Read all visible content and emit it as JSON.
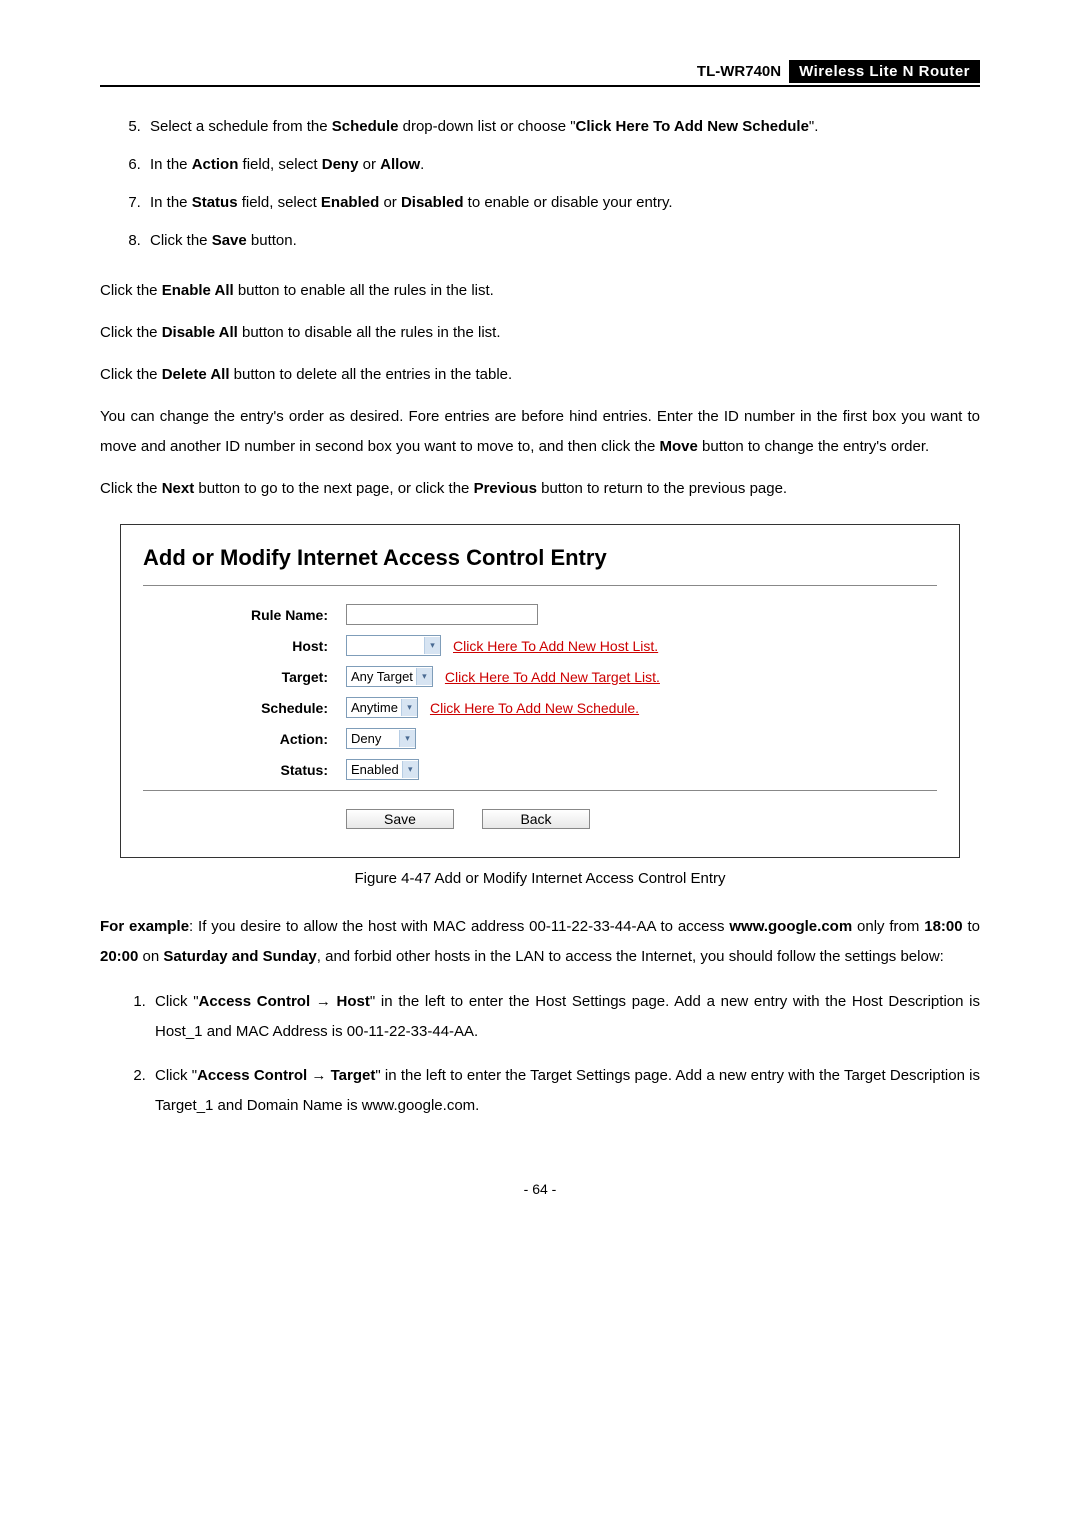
{
  "header": {
    "model": "TL-WR740N",
    "desc": "Wireless Lite N Router"
  },
  "steps": {
    "s5_pre": "Select a schedule from the ",
    "s5_b1": "Schedule",
    "s5_mid": " drop-down list or choose \"",
    "s5_b2": "Click Here To Add New Schedule",
    "s5_post": "\".",
    "s6_pre": "In the ",
    "s6_b1": "Action",
    "s6_mid1": " field, select ",
    "s6_b2": "Deny",
    "s6_mid2": " or ",
    "s6_b3": "Allow",
    "s6_post": ".",
    "s7_pre": "In the ",
    "s7_b1": "Status",
    "s7_mid1": " field, select ",
    "s7_b2": "Enabled",
    "s7_mid2": " or ",
    "s7_b3": "Disabled",
    "s7_post": " to enable or disable your entry.",
    "s8_pre": " Click the ",
    "s8_b1": "Save",
    "s8_post": " button."
  },
  "paras": {
    "p1_pre": "Click the ",
    "p1_b": "Enable All",
    "p1_post": " button to enable all the rules in the list.",
    "p2_pre": "Click the ",
    "p2_b": "Disable All",
    "p2_post": " button to disable all the rules in the list.",
    "p3_pre": "Click the ",
    "p3_b": "Delete All",
    "p3_post": " button to delete all the entries in the table.",
    "p4_pre": "You can change the entry's order as desired. Fore entries are before hind entries. Enter the ID number in the first box you want to move and another ID number in second box you want to move to, and then click the ",
    "p4_b": "Move",
    "p4_post": " button to change the entry's order.",
    "p5_pre": "Click the ",
    "p5_b1": "Next",
    "p5_mid": " button to go to the next page, or click the ",
    "p5_b2": "Previous",
    "p5_post": " button to return to the previous page."
  },
  "figure": {
    "title": "Add or Modify Internet Access Control Entry",
    "labels": {
      "rule": "Rule Name:",
      "host": "Host:",
      "target": "Target:",
      "schedule": "Schedule:",
      "action": "Action:",
      "status": "Status:"
    },
    "values": {
      "host": "",
      "target": "Any Target",
      "schedule": "Anytime",
      "action": "Deny",
      "status": "Enabled"
    },
    "links": {
      "host": "Click Here To Add New Host List.",
      "target": "Click Here To Add New Target List.",
      "schedule": "Click Here To Add New Schedule."
    },
    "buttons": {
      "save": "Save",
      "back": "Back"
    },
    "caption": "Figure 4-47    Add or Modify Internet Access Control Entry"
  },
  "example": {
    "lead_b1": "For example",
    "lead_t1": ": If you desire to allow the host with MAC address 00-11-22-33-44-AA to access ",
    "lead_b2": "www.google.com",
    "lead_t2": " only from ",
    "lead_b3": "18:00",
    "lead_t3": " to ",
    "lead_b4": "20:00",
    "lead_t4": " on ",
    "lead_b5": "Saturday and Sunday",
    "lead_t5": ", and forbid other hosts in the LAN to access the Internet, you should follow the settings below:",
    "li1_pre": "Click \"",
    "li1_b1": "Access Control  →  Host",
    "li1_post": "\" in the left to enter the Host Settings page. Add a new entry with the Host Description is Host_1 and MAC Address is 00-11-22-33-44-AA.",
    "li2_pre": "Click \"",
    "li2_b1": "Access Control  →  Target",
    "li2_post": "\" in the left to enter the Target Settings page. Add a new entry with the Target Description is Target_1 and Domain Name is www.google.com."
  },
  "page_num": "- 64 -"
}
